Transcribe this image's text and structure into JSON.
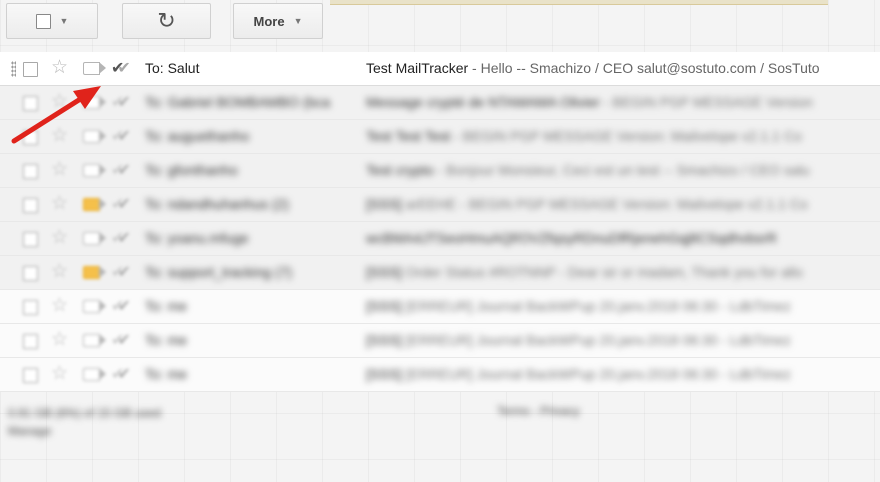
{
  "toolbar": {
    "more_label": "More",
    "refresh_icon": "↻",
    "select_icon": "checkbox-icon"
  },
  "inbox": {
    "selected_row": {
      "to": "To: Salut",
      "subject": "Test MailTracker",
      "snippet": " - Hello -- Smachizo / CEO salut@sostuto.com / SosTuto"
    },
    "blurred_rows": [
      {
        "to": "To: Gabriel BOMBAMBO (bca",
        "subject": "Message crypté de NTAMAMA Olivier",
        "snippet": " - BEGIN PGP MESSAGE Version",
        "important": false
      },
      {
        "to": "To: auguethanho",
        "subject": "Test Test Test",
        "snippet": " - BEGIN PGP MESSAGE Version: Mailvelope v2.1.1 Co",
        "important": false
      },
      {
        "to": "To: gfonthanho",
        "subject": "Test crypto",
        "snippet": " - Bonjour Monsieur, Ceci est un test -- Smachizo / CEO salu",
        "important": false
      },
      {
        "to": "To: ndandhuhanhus (2)",
        "subject": "[SSS]",
        "snippet": " arEEHE - BEGIN PGP MESSAGE Version: Mailvelope v2.1.1 Co",
        "important": true
      },
      {
        "to": "To: yoanu.mfuge",
        "subject": "wcBMA4JTSeoHmuAQf/OVZfqsyRDnuDfRjenehGqj8CSqdhvbsrR",
        "snippet": "",
        "important": false
      },
      {
        "to": "To: support_tracking (7)",
        "subject": "[SSS]",
        "snippet": " Order Status #ROTNNP - Dear sir or madam, Thank you for allo",
        "important": true
      },
      {
        "to": "To: me",
        "subject": "[SSS]",
        "snippet": " [ERREUR] Journal BackWPup 20.janv.2018 06:30 - LdbTimez",
        "important": false
      },
      {
        "to": "To: me",
        "subject": "[SSS]",
        "snippet": " [ERREUR] Journal BackWPup 20.janv.2018 06:30 - LdbTimez",
        "important": false
      },
      {
        "to": "To: me",
        "subject": "[SSS]",
        "snippet": " [ERREUR] Journal BackWPup 20.janv.2018 06:30 - LdbTimez",
        "important": false
      }
    ]
  },
  "footer": {
    "storage_line": "0.91 GB (6%) of 15 GB used",
    "manage_label": "Manage",
    "links": "Terms - Privacy"
  },
  "colors": {
    "arrow": "#e0231b",
    "important_label": "#f5c04a"
  }
}
